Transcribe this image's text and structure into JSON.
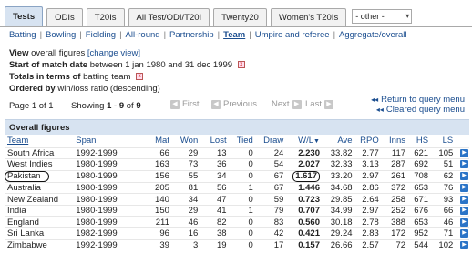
{
  "tabs": [
    {
      "label": "Tests",
      "active": true
    },
    {
      "label": "ODIs",
      "active": false
    },
    {
      "label": "T20Is",
      "active": false
    },
    {
      "label": "All Test/ODI/T20I",
      "active": false
    },
    {
      "label": "Twenty20",
      "active": false
    },
    {
      "label": "Women's T20Is",
      "active": false
    }
  ],
  "tab_select": {
    "value": "- other -"
  },
  "nav": {
    "items": [
      {
        "label": "Batting",
        "active": false
      },
      {
        "label": "Bowling",
        "active": false
      },
      {
        "label": "Fielding",
        "active": false
      },
      {
        "label": "All-round",
        "active": false
      },
      {
        "label": "Partnership",
        "active": false
      },
      {
        "label": "Team",
        "active": true
      },
      {
        "label": "Umpire and referee",
        "active": false
      },
      {
        "label": "Aggregate/overall",
        "active": false
      }
    ]
  },
  "info": {
    "view_label": "View",
    "view_text": "overall figures",
    "change_view": "[change view]",
    "start_label": "Start of match date",
    "start_text": "between 1 jan 1980 and 31 dec 1999",
    "totals_label": "Totals in terms of",
    "totals_text": "batting team",
    "order_label": "Ordered by",
    "order_text": "win/loss ratio (descending)"
  },
  "pager": {
    "page_text": "Page 1 of 1",
    "showing_prefix": "Showing",
    "showing_range": "1 - 9",
    "showing_of": "of",
    "showing_total": "9",
    "first": "First",
    "previous": "Previous",
    "next": "Next",
    "last": "Last",
    "return_link": "Return to query menu",
    "cleared_link": "Cleared query menu"
  },
  "table": {
    "title": "Overall figures",
    "columns": [
      "Team",
      "Span",
      "Mat",
      "Won",
      "Lost",
      "Tied",
      "Draw",
      "W/L",
      "Ave",
      "RPO",
      "Inns",
      "HS",
      "LS"
    ],
    "rows": [
      [
        "South Africa",
        "1992-1999",
        "66",
        "29",
        "13",
        "0",
        "24",
        "2.230",
        "33.82",
        "2.77",
        "117",
        "621",
        "105"
      ],
      [
        "West Indies",
        "1980-1999",
        "163",
        "73",
        "36",
        "0",
        "54",
        "2.027",
        "32.33",
        "3.13",
        "287",
        "692",
        "51"
      ],
      [
        "Pakistan",
        "1980-1999",
        "156",
        "55",
        "34",
        "0",
        "67",
        "1.617",
        "33.20",
        "2.97",
        "261",
        "708",
        "62"
      ],
      [
        "Australia",
        "1980-1999",
        "205",
        "81",
        "56",
        "1",
        "67",
        "1.446",
        "34.68",
        "2.86",
        "372",
        "653",
        "76"
      ],
      [
        "New Zealand",
        "1980-1999",
        "140",
        "34",
        "47",
        "0",
        "59",
        "0.723",
        "29.85",
        "2.64",
        "258",
        "671",
        "93"
      ],
      [
        "India",
        "1980-1999",
        "150",
        "29",
        "41",
        "1",
        "79",
        "0.707",
        "34.99",
        "2.97",
        "252",
        "676",
        "66"
      ],
      [
        "England",
        "1980-1999",
        "211",
        "46",
        "82",
        "0",
        "83",
        "0.560",
        "30.18",
        "2.78",
        "388",
        "653",
        "46"
      ],
      [
        "Sri Lanka",
        "1982-1999",
        "96",
        "16",
        "38",
        "0",
        "42",
        "0.421",
        "29.24",
        "2.83",
        "172",
        "952",
        "71"
      ],
      [
        "Zimbabwe",
        "1992-1999",
        "39",
        "3",
        "19",
        "0",
        "17",
        "0.157",
        "26.66",
        "2.57",
        "72",
        "544",
        "102"
      ]
    ]
  }
}
